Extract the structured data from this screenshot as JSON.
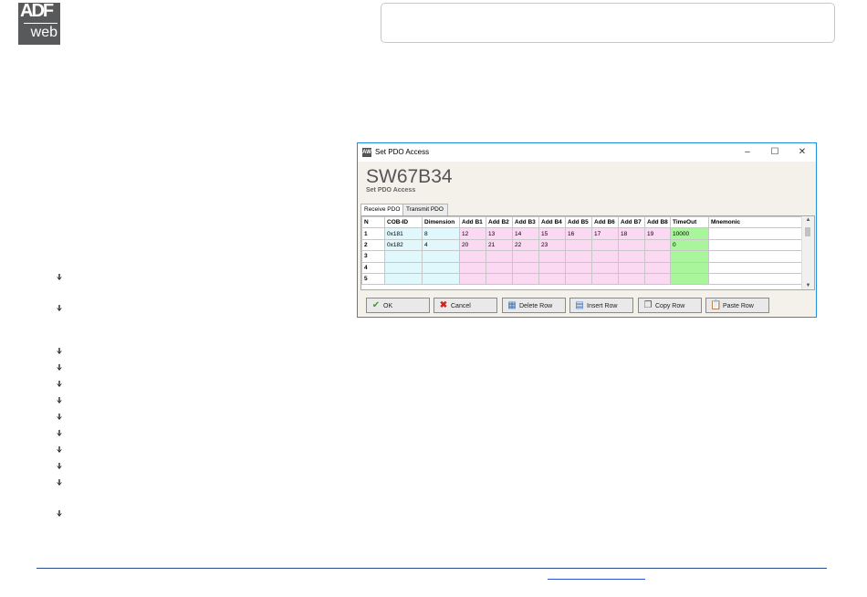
{
  "dialog": {
    "title": "Set PDO Access",
    "header_title": "SW67B34",
    "header_subtitle": "Set PDO Access",
    "window_buttons": {
      "minimize": "–",
      "maximize": "☐",
      "close": "✕"
    },
    "tabs": [
      {
        "label": "Receive PDO",
        "active": true
      },
      {
        "label": "Transmit PDO",
        "active": false
      }
    ],
    "table": {
      "columns": [
        "N",
        "COB-ID",
        "Dimension",
        "Add B1",
        "Add B2",
        "Add B3",
        "Add B4",
        "Add B5",
        "Add B6",
        "Add B7",
        "Add B8",
        "TimeOut",
        "Mnemonic"
      ],
      "rows": [
        [
          "1",
          "0x181",
          "8",
          "12",
          "13",
          "14",
          "15",
          "16",
          "17",
          "18",
          "19",
          "10000",
          ""
        ],
        [
          "2",
          "0x182",
          "4",
          "20",
          "21",
          "22",
          "23",
          "",
          "",
          "",
          "",
          "0",
          ""
        ],
        [
          "3",
          "",
          "",
          "",
          "",
          "",
          "",
          "",
          "",
          "",
          "",
          "",
          ""
        ],
        [
          "4",
          "",
          "",
          "",
          "",
          "",
          "",
          "",
          "",
          "",
          "",
          "",
          ""
        ],
        [
          "5",
          "",
          "",
          "",
          "",
          "",
          "",
          "",
          "",
          "",
          "",
          "",
          ""
        ]
      ]
    },
    "buttons": {
      "ok": "OK",
      "cancel": "Cancel",
      "delete_row": "Delete Row",
      "insert_row": "Insert Row",
      "copy_row": "Copy Row",
      "paste_row": "Paste Row"
    },
    "icons": {
      "ok": "checkmark-icon",
      "cancel": "red-x-icon",
      "delete_row": "delete-row-icon",
      "insert_row": "insert-row-icon",
      "copy_row": "copy-icon",
      "paste_row": "paste-icon"
    }
  },
  "colors": {
    "cyan": "#e0f7fb",
    "pink": "#fbd9f2",
    "green": "#a9f59c",
    "window_border": "#1e8fdd"
  }
}
